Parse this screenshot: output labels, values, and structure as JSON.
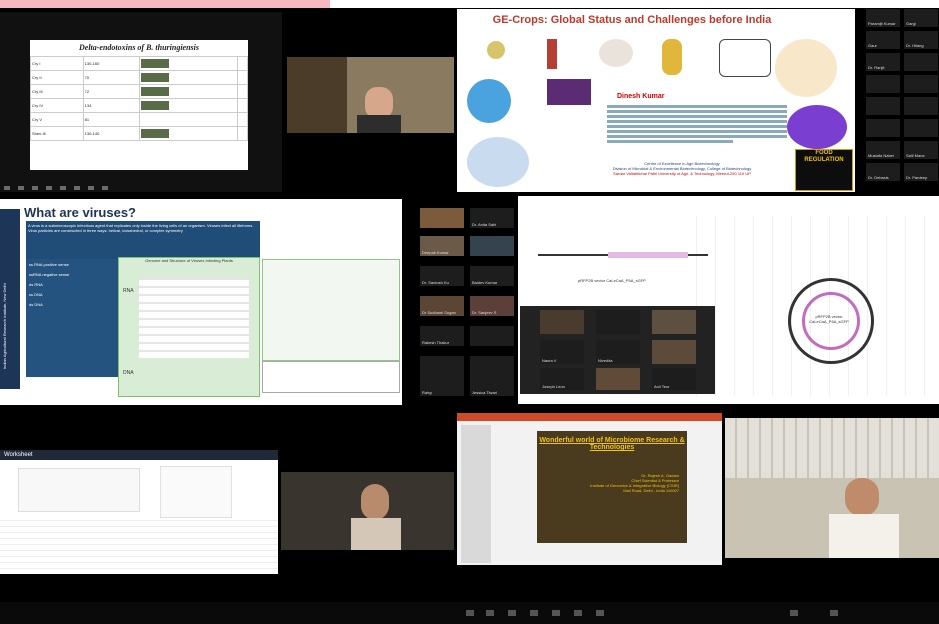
{
  "slide1": {
    "title": "Delta-endotoxins of B. thuringiensis",
    "rows": [
      {
        "name": "Cry I",
        "value": "130-160"
      },
      {
        "name": "Cry II",
        "value": "70"
      },
      {
        "name": "Cry III",
        "value": "72"
      },
      {
        "name": "Cry IV",
        "value": "134"
      },
      {
        "name": "Cry V",
        "value": "81"
      },
      {
        "name": "Shen-Ili",
        "value": "130-140"
      }
    ]
  },
  "ge_slide": {
    "title": "GE-Crops: Global Status and Challenges before India",
    "presenter": "Dinesh Kumar",
    "footer_line1": "Centre of Excellence in Agri Biotechnology",
    "footer_line2": "Division of Microbial & Environmental Biotechnology, College of Biotechnology",
    "footer_line3": "Sardar Vallabhbhai Patel University of Agri. & Technology, Meerut-250 110 UP",
    "food_label": "FOOD REGULATION"
  },
  "viruses_slide": {
    "title": "What are viruses?",
    "intro": "A virus is a submicroscopic infectious agent that replicates only inside the living cells of an organism. Viruses infect all lifeforms. Virus particles are constructed in three ways: helical, icosahedral, or complex symmetry",
    "side_label": "Indian Agricultural Research Institute, New Delhi",
    "list": [
      "ss RNA positive sense",
      "ssRNA negative sense",
      "ds RNA",
      "ss DNA",
      "ds DNA"
    ],
    "diagram_caption": "Genome and Structure of Viruses Infecting Plants",
    "rna_label": "RNA",
    "dna_label": "DNA"
  },
  "gallery_names": [
    "Dr. Anita Sahi",
    "Deepak Kumar",
    "Dr. Santosh Ku",
    "Baldev Kumar",
    "Dr Sudhami Sugan",
    "Dr. Sanjeev S",
    "Rakesh Thakur",
    "Raisy",
    "Jessica Tiwari",
    "Nasra V",
    "Nivedita",
    "Joseph Leon",
    "Anil Teur"
  ],
  "right_column_names": [
    "Paramjit Kumar",
    "Gargi",
    "Gaur",
    "Dr. Hilang",
    "Dr. Ranjit",
    "Mustafa Nabel",
    "Salil Mane",
    "Dr. Debasis",
    "Dr. Pardeep"
  ],
  "plasmid": {
    "vector1": "pRFP2B vector CaLeCaA_P5A_sGFP",
    "vector2": "pRFP2B vector CaLeCaA_P5A_sGFP"
  },
  "micro_slide": {
    "title": "Wonderful world of Microbiome Research & Technologies",
    "presenter": "Dr. Rajesh A. Gadam",
    "role": "Chief Scientist & Professor",
    "institute": "Institute of Genomics & Integrative Biology (CSIR)",
    "address": "Mall Road, Delhi - India 110007"
  },
  "spreadsheet": {
    "app": "Worksheet"
  }
}
